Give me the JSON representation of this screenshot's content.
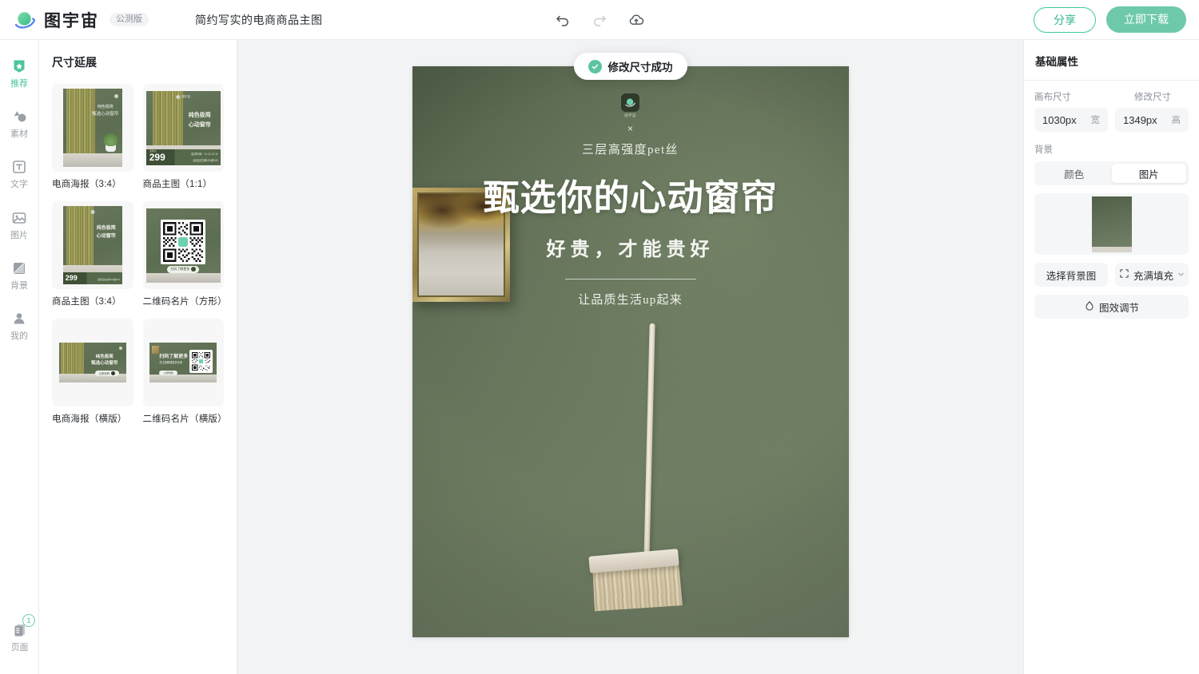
{
  "header": {
    "brand_name": "图宇宙",
    "beta_tag": "公测版",
    "doc_title": "简约写实的电商商品主图",
    "undo_icon": "undo-icon",
    "redo_icon": "redo-icon",
    "cloud_save_icon": "cloud-upload-icon",
    "share_label": "分享",
    "download_label": "立即下载",
    "accent_color": "#6ec9ab"
  },
  "rail": {
    "items": [
      {
        "label": "推荐",
        "icon": "badge-star-icon",
        "active": true
      },
      {
        "label": "素材",
        "icon": "shapes-icon",
        "active": false
      },
      {
        "label": "文字",
        "icon": "text-box-icon",
        "active": false
      },
      {
        "label": "图片",
        "icon": "image-icon",
        "active": false
      },
      {
        "label": "背景",
        "icon": "background-icon",
        "active": false
      },
      {
        "label": "我的",
        "icon": "user-icon",
        "active": false
      }
    ],
    "pages": {
      "label": "页面",
      "badge": "1",
      "icon": "pages-icon"
    }
  },
  "panel": {
    "title": "尺寸延展",
    "thumbs": [
      {
        "label": "电商海报（3:4）",
        "kind": "poster-portrait"
      },
      {
        "label": "商品主图（1:1）",
        "kind": "product-square"
      },
      {
        "label": "商品主图（3:4）",
        "kind": "product-portrait"
      },
      {
        "label": "二维码名片（方形）",
        "kind": "qr-square"
      },
      {
        "label": "电商海报（横版）",
        "kind": "poster-landscape"
      },
      {
        "label": "二维码名片（横版）",
        "kind": "qr-landscape"
      }
    ],
    "art_text": {
      "line1": "纯色极简",
      "line2": "心动窗帘",
      "line2_alt": "甄选心动窗帘",
      "price": "299",
      "price_unit": "元",
      "price_tag": "活动价",
      "time_label": "活动时间：11.11-11.11",
      "promo": "活动且在满100减100",
      "scan_title": "扫码了解更多",
      "scan_sub": "关注我解锁更多优惠",
      "cta": "立即抢购",
      "logo_text": "图宇宙"
    }
  },
  "stage": {
    "toast": {
      "text": "修改尺寸成功",
      "icon": "check-circle-icon"
    },
    "artboard": {
      "badge_sub": "图宇宙",
      "cross": "×",
      "sub1": "三层高强度pet丝",
      "headline": "甄选你的心动窗帘",
      "sub2": "好贵，才能贵好",
      "sub3": "让品质生活up起来",
      "bg_color": "#606f56"
    }
  },
  "props": {
    "title": "基础属性",
    "canvas_size_label": "画布尺寸",
    "modify_size_label": "修改尺寸",
    "width_value": "1030px",
    "width_unit": "宽",
    "height_value": "1349px",
    "height_unit": "高",
    "background_label": "背景",
    "tab_color": "颜色",
    "tab_image": "图片",
    "active_tab": "图片",
    "choose_bg_label": "选择背景图",
    "fill_mode_label": "充满填充",
    "fill_mode_icon": "crop-frame-icon",
    "adjust_label": "图效调节",
    "adjust_icon": "droplet-icon"
  }
}
